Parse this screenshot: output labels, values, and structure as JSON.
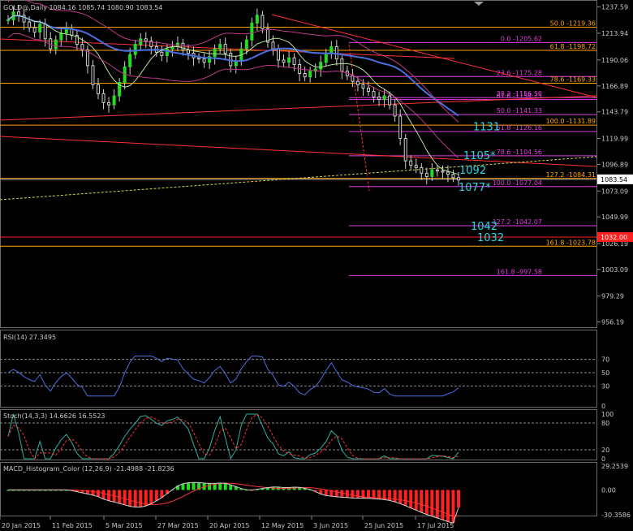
{
  "chart_data": {
    "type": "candlestick",
    "price_panel": {
      "header": "GOLD@,Daily  1084.16 1085.74 1080.90 1083.54",
      "ylim": [
        951.5,
        1240
      ],
      "y_ticks": [
        1237.59,
        1213.94,
        1190.06,
        1166.89,
        1143.79,
        1119.99,
        1096.89,
        1073.09,
        1049.99,
        1026.19,
        1003.09,
        979.29,
        956.19
      ],
      "current_price": {
        "value": 1083.54,
        "label": "1083.54"
      },
      "red_marker": {
        "value": 1032.0,
        "label": "1032.00"
      },
      "fib_levels": [
        {
          "value": 1219.36,
          "label": "50.0 -1219.36",
          "color": "#ffa500"
        },
        {
          "value": 1205.62,
          "label": "0.0 -1205.62",
          "color": "#e040e0"
        },
        {
          "value": 1198.72,
          "label": "61.8 -1198.72",
          "color": "#ffa500"
        },
        {
          "value": 1175.28,
          "label": "23.6 -1175.28",
          "color": "#e040e0"
        },
        {
          "value": 1169.33,
          "label": "78.6 -1169.33",
          "color": "#ffa500"
        },
        {
          "value": 1156.5,
          "label": "38.2 -1156.50",
          "color": "#e040e0"
        },
        {
          "value": 1154.75,
          "label": "61.8 -1154.75",
          "color": "#e040e0"
        },
        {
          "value": 1141.33,
          "label": "50.0 -1141.33",
          "color": "#e040e0"
        },
        {
          "value": 1131.89,
          "label": "100.0 -1131.89",
          "color": "#ffa500"
        },
        {
          "value": 1126.16,
          "label": "61.8 -1126.16",
          "color": "#e040e0"
        },
        {
          "value": 1104.56,
          "label": "78.6 -1104.56",
          "color": "#e040e0"
        },
        {
          "value": 1084.31,
          "label": "127.2 -1084.31",
          "color": "#ffa500"
        },
        {
          "value": 1077.04,
          "label": "100.0 -1077.04",
          "color": "#e040e0"
        },
        {
          "value": 1042.07,
          "label": "127.2 -1042.07",
          "color": "#e040e0"
        },
        {
          "value": 1023.78,
          "label": "161.8 -1023.78",
          "color": "#ffa500"
        },
        {
          "value": 997.58,
          "label": "161.8 -997.58",
          "color": "#e040e0"
        }
      ],
      "annotations": [
        {
          "text": "1131",
          "value": 1131
        },
        {
          "text": "1105*",
          "value": 1105
        },
        {
          "text": "1092",
          "value": 1092
        },
        {
          "text": "1077*",
          "value": 1077
        },
        {
          "text": "1042",
          "value": 1042
        },
        {
          "text": "1032",
          "value": 1032
        }
      ],
      "x_labels": [
        "20 Jan 2015",
        "11 Feb 2015",
        "5 Mar 2015",
        "27 Mar 2015",
        "20 Apr 2015",
        "12 May 2015",
        "3 Jun 2015",
        "25 Jun 2015",
        "17 Jul 2015"
      ],
      "close_path": [
        1226,
        1233,
        1230,
        1224,
        1219,
        1215,
        1222,
        1209,
        1200,
        1208,
        1214,
        1218,
        1212,
        1204,
        1199,
        1185,
        1168,
        1160,
        1152,
        1150,
        1158,
        1170,
        1184,
        1195,
        1204,
        1209,
        1207,
        1202,
        1197,
        1194,
        1200,
        1202,
        1205,
        1199,
        1196,
        1192,
        1191,
        1188,
        1193,
        1200,
        1204,
        1196,
        1185,
        1189,
        1200,
        1208,
        1223,
        1230,
        1218,
        1206,
        1200,
        1190,
        1188,
        1192,
        1186,
        1178,
        1175,
        1180,
        1182,
        1188,
        1196,
        1202,
        1191,
        1180,
        1176,
        1171,
        1168,
        1165,
        1162,
        1157,
        1155,
        1158,
        1150,
        1140,
        1120,
        1100,
        1096,
        1094,
        1089,
        1086,
        1092,
        1091,
        1090,
        1088,
        1085,
        1083
      ]
    },
    "rsi": {
      "header": "RSI(14) 27.3495",
      "levels": [
        70,
        50,
        30
      ],
      "ticks": [
        70,
        50,
        30,
        0
      ],
      "ylim": [
        0,
        100
      ],
      "value": 27.3495
    },
    "stoch": {
      "header": "Stoch(14,3,3) 14.6626 16.5523",
      "ticks": [
        100,
        80,
        20,
        0
      ],
      "ylim": [
        0,
        100
      ],
      "values": [
        14.6626,
        16.5523
      ]
    },
    "macd": {
      "header": "MACD_Histogram_Color (12,26,9) -21.4988 -21.8236",
      "ticks": [
        "29.2539",
        "0.00",
        "-30.3586"
      ],
      "ylim": [
        -30.3586,
        29.2539
      ],
      "values": [
        -21.4988,
        -21.8236
      ]
    }
  }
}
